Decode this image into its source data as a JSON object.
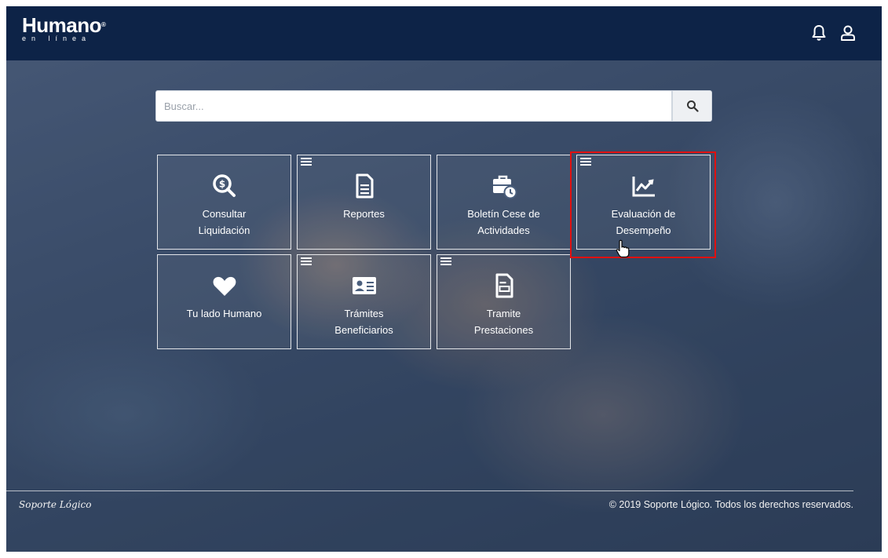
{
  "app": {
    "logo_main": "Humano",
    "logo_reg": "®",
    "logo_sub": "en línea",
    "notification_icon": "bell-icon",
    "user_icon": "user-icon"
  },
  "search": {
    "placeholder": "Buscar...",
    "value": "",
    "button_icon": "search-icon"
  },
  "tiles": [
    {
      "label_line1": "Consultar",
      "label_line2": "Liquidación",
      "icon": "search-dollar-icon",
      "has_menu": false
    },
    {
      "label_line1": "Reportes",
      "label_line2": "",
      "icon": "document-icon",
      "has_menu": true
    },
    {
      "label_line1": "Boletín Cese de",
      "label_line2": "Actividades",
      "icon": "briefcase-clock-icon",
      "has_menu": false
    },
    {
      "label_line1": "Evaluación de",
      "label_line2": "Desempeño",
      "icon": "chart-line-icon",
      "has_menu": true,
      "highlighted": true
    },
    {
      "label_line1": "Tu lado Humano",
      "label_line2": "",
      "icon": "heart-icon",
      "has_menu": false
    },
    {
      "label_line1": "Trámites",
      "label_line2": "Beneficiarios",
      "icon": "id-card-icon",
      "has_menu": true
    },
    {
      "label_line1": "Tramite",
      "label_line2": "Prestaciones",
      "icon": "file-form-icon",
      "has_menu": true
    }
  ],
  "footer": {
    "signature": "Soporte Lógico",
    "copyright": "© 2019 Soporte Lógico. Todos los derechos reservados."
  },
  "colors": {
    "topbar": "#0d2347",
    "highlight_box": "#e01010",
    "tile_border": "#ffffff"
  }
}
